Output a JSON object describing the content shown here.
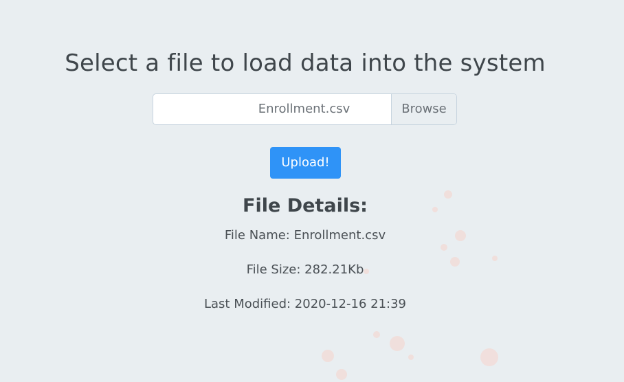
{
  "header": {
    "title": "Select a file to load data into the system"
  },
  "file_input": {
    "selected_file": "Enrollment.csv",
    "browse_label": "Browse"
  },
  "actions": {
    "upload_label": "Upload!"
  },
  "details": {
    "title": "File Details:",
    "name_line": "File Name: Enrollment.csv",
    "size_line": "File Size: 282.21Kb",
    "modified_line": "Last Modified: 2020-12-16 21:39"
  },
  "colors": {
    "background": "#e9eef1",
    "accent": "#2f93f7",
    "text": "#41474c"
  }
}
